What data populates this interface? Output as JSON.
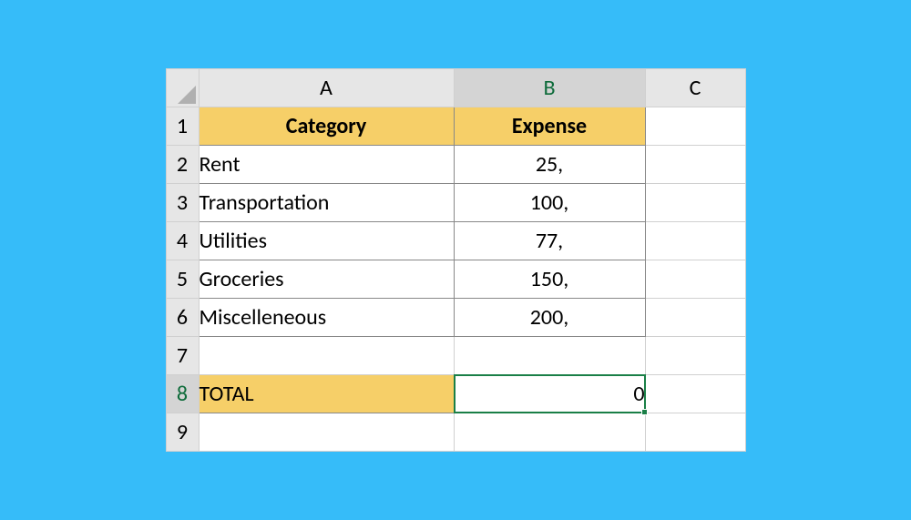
{
  "columns": {
    "a": "A",
    "b": "B",
    "c": "C"
  },
  "rows": {
    "r1": "1",
    "r2": "2",
    "r3": "3",
    "r4": "4",
    "r5": "5",
    "r6": "6",
    "r7": "7",
    "r8": "8",
    "r9": "9"
  },
  "header": {
    "category": "Category",
    "expense": "Expense"
  },
  "items": [
    {
      "category": "Rent",
      "expense": "25,"
    },
    {
      "category": "Transportation",
      "expense": "100,"
    },
    {
      "category": "Utilities",
      "expense": "77,"
    },
    {
      "category": "Groceries",
      "expense": "150,"
    },
    {
      "category": "Miscelleneous",
      "expense": "200,"
    }
  ],
  "total": {
    "label": "TOTAL",
    "value": "0"
  },
  "selected_cell": "B8"
}
